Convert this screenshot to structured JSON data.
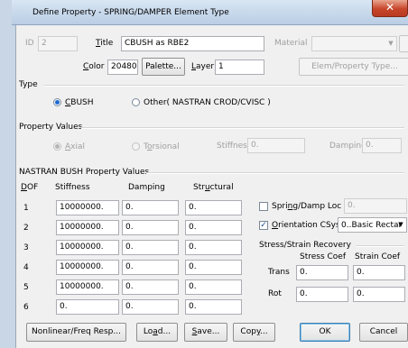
{
  "window": {
    "title": "Define Property - SPRING/DAMPER Element Type",
    "close_glyph": "✕"
  },
  "header": {
    "id_label": "ID",
    "id_value": "2",
    "title_label": "Title",
    "title_value": "CBUSH as RBE2",
    "material_label": "Material",
    "color_label": "Color",
    "color_value": "20480",
    "palette_button": "Palette...",
    "layer_label": "Layer",
    "layer_value": "1",
    "elem_prop_button": "Elem/Property Type..."
  },
  "type_group": {
    "label": "Type",
    "options": [
      {
        "label": "CBUSH",
        "selected": true
      },
      {
        "label": "Other( NASTRAN CROD/CVISC )",
        "selected": false
      }
    ]
  },
  "property_values": {
    "label": "Property Values",
    "axial_label": "Axial",
    "torsional_label": "Torsional",
    "stiffness_label": "Stiffness",
    "stiffness_value": "0.",
    "damping_label": "Damping",
    "damping_value": "0."
  },
  "bush": {
    "label": "NASTRAN BUSH Property Values",
    "headers": [
      "DOF",
      "Stiffness",
      "Damping",
      "Structural"
    ],
    "rows": [
      {
        "dof": "1",
        "stiffness": "10000000.",
        "damping": "0.",
        "structural": "0."
      },
      {
        "dof": "2",
        "stiffness": "10000000.",
        "damping": "0.",
        "structural": "0."
      },
      {
        "dof": "3",
        "stiffness": "10000000.",
        "damping": "0.",
        "structural": "0."
      },
      {
        "dof": "4",
        "stiffness": "10000000.",
        "damping": "0.",
        "structural": "0."
      },
      {
        "dof": "5",
        "stiffness": "10000000.",
        "damping": "0.",
        "structural": "0."
      },
      {
        "dof": "6",
        "stiffness": "0.",
        "damping": "0.",
        "structural": "0."
      }
    ],
    "spring_damp_loc_label": "Spring/Damp Loc",
    "spring_damp_loc_value": "0.",
    "orientation_label": "Orientation CSys",
    "orientation_value": "0..Basic Rectar",
    "recovery": {
      "label": "Stress/Strain Recovery",
      "stress_coef_label": "Stress Coef",
      "strain_coef_label": "Strain Coef",
      "trans_label": "Trans",
      "trans_stress": "0.",
      "trans_strain": "0.",
      "rot_label": "Rot",
      "rot_stress": "0.",
      "rot_strain": "0."
    }
  },
  "buttons": {
    "nonlinear": "Nonlinear/Freq Resp...",
    "load": "Load...",
    "save": "Save...",
    "copy": "Copy...",
    "ok": "OK",
    "cancel": "Cancel"
  },
  "icons": {
    "dropdown": "▼",
    "check": "✓"
  }
}
